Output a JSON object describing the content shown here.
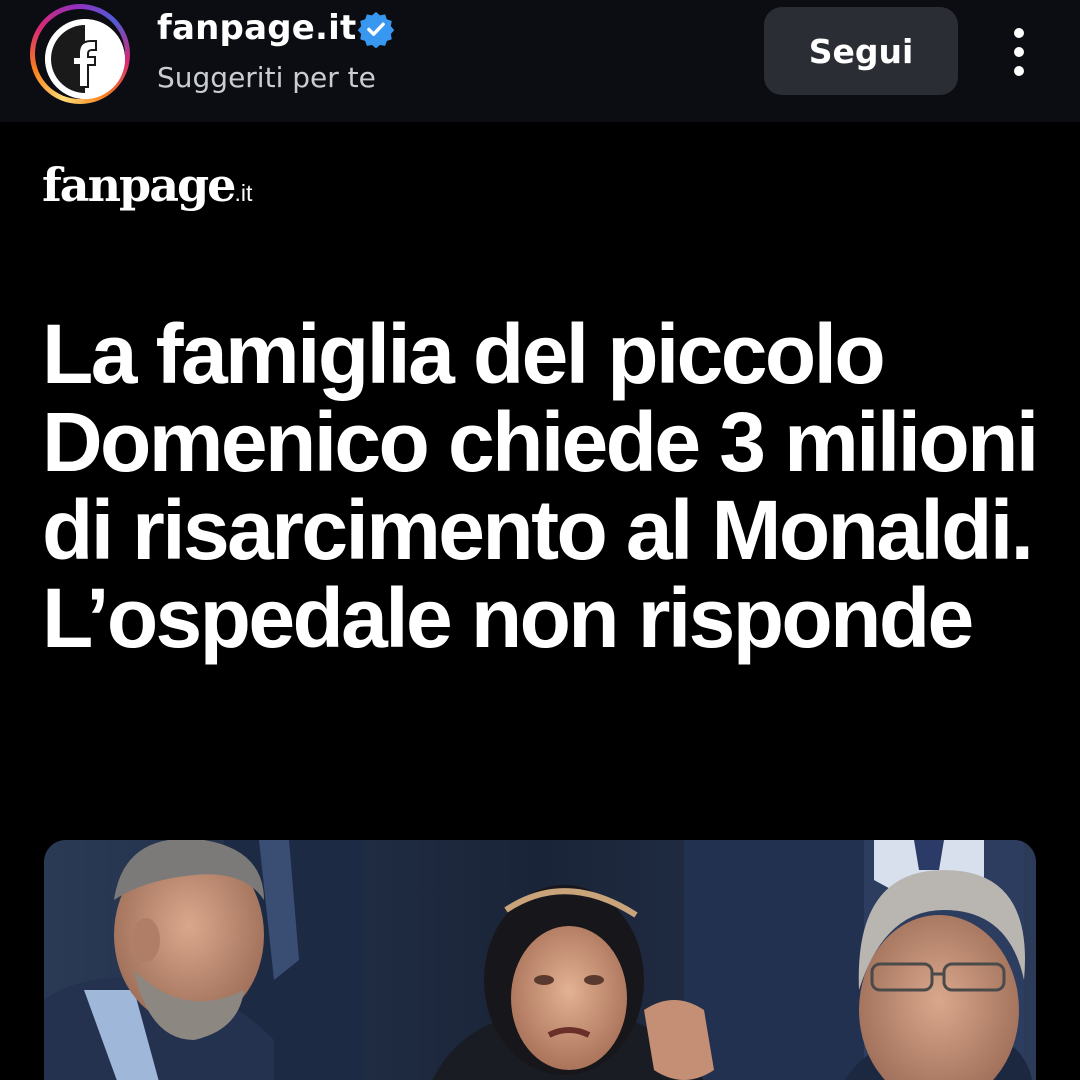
{
  "header": {
    "account_name": "fanpage.it",
    "verified": true,
    "subtitle": "Suggeriti per te",
    "follow_label": "Segui",
    "avatar_icon": "fanpage-logo-icon",
    "more_icon": "more-vertical-icon"
  },
  "post": {
    "brand_name": "fanpage",
    "brand_tld": ".it",
    "headline": "La famiglia del piccolo Domenico chiede 3 milioni di risarcimento al Monaldi. L’ospedale non risponde",
    "photo_icon": "news-photo"
  },
  "colors": {
    "background": "#000000",
    "header_bg": "#0b0d12",
    "follow_button_bg": "#2a2d34",
    "verified_badge": "#3897f0",
    "text_primary": "#ffffff",
    "text_secondary": "#c9ccd3"
  }
}
